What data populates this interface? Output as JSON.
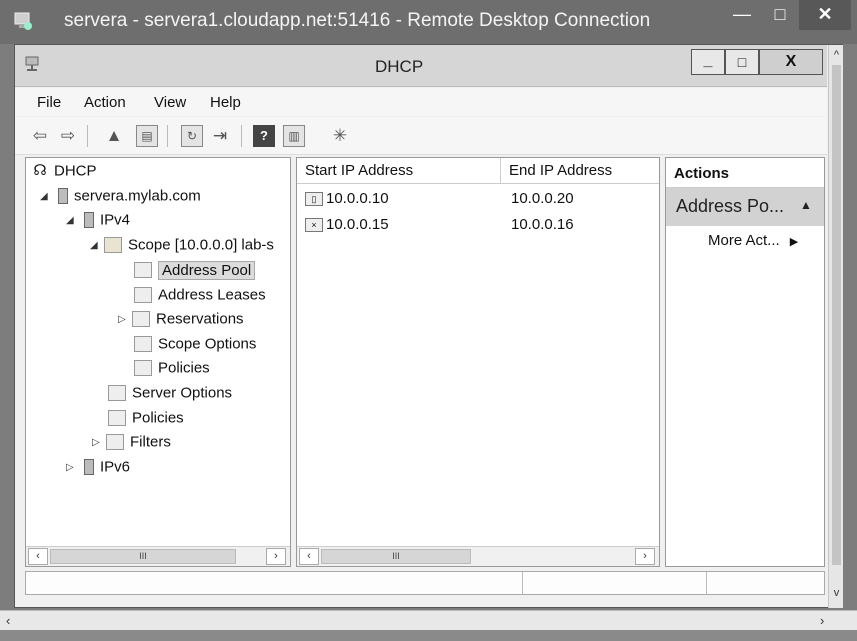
{
  "rdp_window": {
    "title": "servera - servera1.cloudapp.net:51416 - Remote Desktop Connection",
    "minimize": "—",
    "maximize": "□",
    "close": "✕"
  },
  "mmc": {
    "title": "DHCP",
    "minimize": "_",
    "maximize": "□",
    "close": "X"
  },
  "menu": [
    "File",
    "Action",
    "View",
    "Help"
  ],
  "toolbar": {
    "back": "⇦",
    "forward": "⇨",
    "up": "▲",
    "show_hide": "▤",
    "refresh": "↻",
    "export": "⇥",
    "help": "?",
    "pane": "▥",
    "scope_icon": "✳"
  },
  "tree": {
    "root": "DHCP",
    "server": "servera.mylab.com",
    "ipv4": "IPv4",
    "scope": "Scope [10.0.0.0] lab-s",
    "address_pool": "Address Pool",
    "address_leases": "Address Leases",
    "reservations": "Reservations",
    "scope_options": "Scope Options",
    "scope_policies": "Policies",
    "server_options": "Server Options",
    "policies": "Policies",
    "filters": "Filters",
    "ipv6": "IPv6"
  },
  "list": {
    "columns": [
      "Start IP Address",
      "End IP Address"
    ],
    "rows": [
      {
        "start": "10.0.0.10",
        "end": "10.0.0.20"
      },
      {
        "start": "10.0.0.15",
        "end": "10.0.0.16"
      }
    ]
  },
  "scrollbars": {
    "left": "‹",
    "right": "›",
    "thumb": "III",
    "up": "^",
    "down": "v"
  },
  "actions": {
    "header": "Actions",
    "section": "Address Po...",
    "section_arrow": "▲",
    "more": "More Act...",
    "more_arrow": "▶"
  }
}
